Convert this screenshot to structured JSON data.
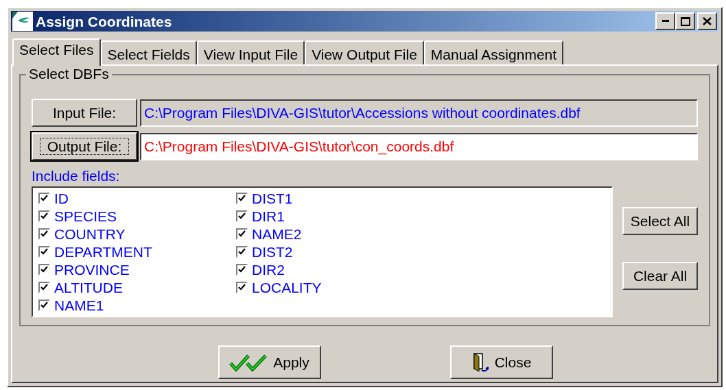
{
  "window": {
    "title": "Assign Coordinates",
    "controls": [
      {
        "kind": "minimize"
      },
      {
        "kind": "maximize"
      },
      {
        "kind": "close"
      }
    ]
  },
  "tabs": [
    {
      "label": "Select Files",
      "selected": true
    },
    {
      "label": "Select Fields",
      "selected": false
    },
    {
      "label": "View Input File",
      "selected": false
    },
    {
      "label": "View Output File",
      "selected": false
    },
    {
      "label": "Manual Assignment",
      "selected": false
    }
  ],
  "group": {
    "title": "Select DBFs"
  },
  "files": [
    {
      "button": "Input File:",
      "path": "C:\\Program Files\\DIVA-GIS\\tutor\\Accessions without coordinates.dbf",
      "editable": false,
      "focused": false,
      "color": "#0000ff"
    },
    {
      "button": "Output File:",
      "path": "C:\\Program Files\\DIVA-GIS\\tutor\\con_coords.dbf",
      "editable": true,
      "focused": true,
      "color": "#ff0000"
    }
  ],
  "include_fields": {
    "label": "Include fields:",
    "fields": [
      {
        "name": "ID",
        "checked": true
      },
      {
        "name": "SPECIES",
        "checked": true
      },
      {
        "name": "COUNTRY",
        "checked": true
      },
      {
        "name": "DEPARTMENT",
        "checked": true
      },
      {
        "name": "PROVINCE",
        "checked": true
      },
      {
        "name": "ALTITUDE",
        "checked": true
      },
      {
        "name": "NAME1",
        "checked": true
      },
      {
        "name": "DIST1",
        "checked": true
      },
      {
        "name": "DIR1",
        "checked": true
      },
      {
        "name": "NAME2",
        "checked": true
      },
      {
        "name": "DIST2",
        "checked": true
      },
      {
        "name": "DIR2",
        "checked": true
      },
      {
        "name": "LOCALITY",
        "checked": true
      }
    ]
  },
  "side_buttons": [
    "Select All",
    "Clear All"
  ],
  "bottom_buttons": [
    {
      "label": "Apply",
      "kind": "apply"
    },
    {
      "label": "Close",
      "kind": "close"
    }
  ]
}
